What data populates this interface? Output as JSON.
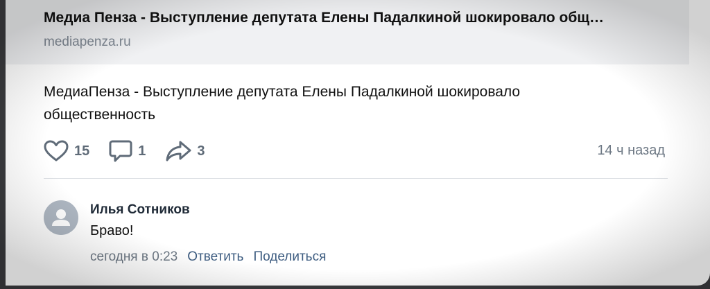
{
  "link_preview": {
    "title": "Медиа Пенза - Выступление депутата Елены Падалкиной шокировало общ…",
    "domain": "mediapenza.ru"
  },
  "post": {
    "text": "МедиаПенза - Выступление депутата Елены Падалкиной шокировало общественность",
    "likes": "15",
    "comments": "1",
    "shares": "3",
    "time": "14 ч назад"
  },
  "comment": {
    "author": "Илья Сотников",
    "text": "Браво!",
    "time": "сегодня в 0:23",
    "reply_label": "Ответить",
    "share_label": "Поделиться"
  },
  "icons": {
    "like": "heart-icon",
    "comment": "comment-bubble-icon",
    "share": "share-arrow-icon",
    "avatar": "user-silhouette-icon"
  },
  "colors": {
    "icon_gray": "#5f6b78",
    "link_blue": "#3d5c80",
    "avatar_bg": "#aeb7c2"
  }
}
